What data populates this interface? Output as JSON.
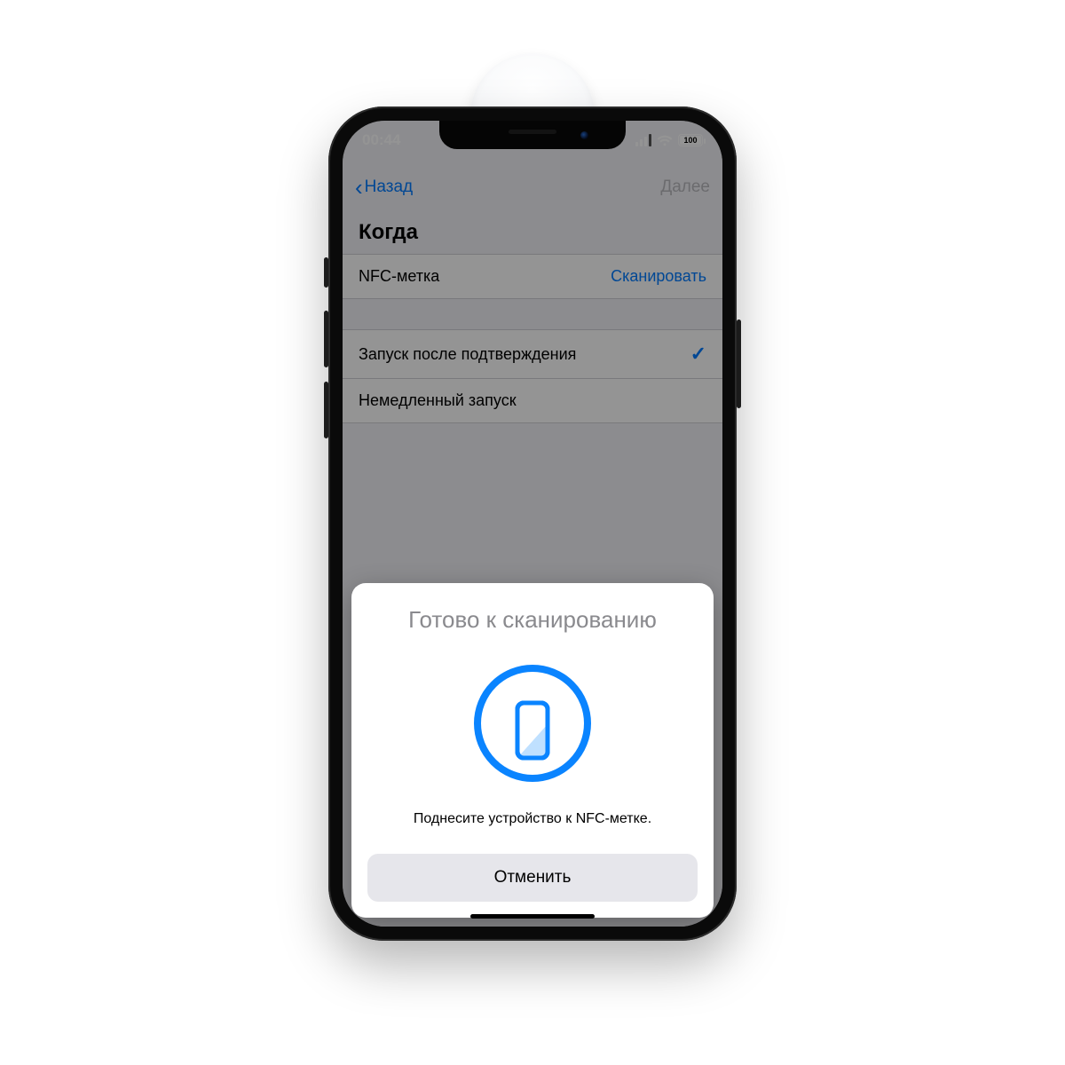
{
  "status": {
    "time": "00:44",
    "battery": "100"
  },
  "nav": {
    "back": "Назад",
    "next": "Далее"
  },
  "section": {
    "title": "Когда"
  },
  "nfc_row": {
    "label": "NFC-метка",
    "action": "Сканировать"
  },
  "options": {
    "confirm": "Запуск после подтверждения",
    "immediate": "Немедленный запуск"
  },
  "sheet": {
    "title": "Готово к сканированию",
    "subtitle": "Поднесите устройство к NFC-метке.",
    "cancel": "Отменить"
  }
}
